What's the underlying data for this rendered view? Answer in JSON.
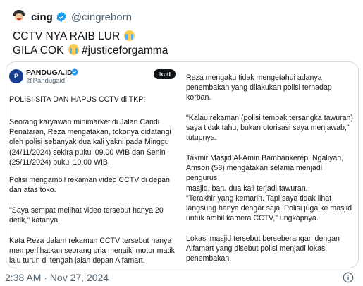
{
  "header": {
    "name": "cing",
    "handle": "@cingreborn"
  },
  "tweet": {
    "line1_text": "CCTV NYA RAIB LUR",
    "line2_text": "GILA COK",
    "hashtag": "#justiceforgamma"
  },
  "media": {
    "account_name": "PANDUGA.ID",
    "account_handle": "@Pandugaid",
    "follow_label": "Ikuti",
    "left_paragraphs": [
      "POLISI SITA DAN HAPUS CCTV di TKP:",
      "Seorang karyawan minimarket di Jalan Candi\nPenataran, Reza mengatakan, tokonya didatangi\noleh polisi sebanyak dua kali yakni pada Minggu\n(24/11/2024) sekira pukul 09.00 WIB dan Senin\n(25/11/2024) pukul 10.00 WIB.",
      "Polisi mengambil rekaman video CCTV di depan\ndan atas toko.",
      " \"Saya sempat melihat video tersebut hanya 20\ndetik,\" katanya.",
      "Kata Reza dalam rekaman CCTV tersebut hanya\nmemperlihatkan seorang pria menaiki motor matik\nlalu turun di tengah jalan depan Alfamart."
    ],
    "right_paragraphs": [
      "Reza mengaku tidak mengetahui adanya\npenembakan yang dilakukan polisi terhadap\nkorban.",
      "\"Kalau rekaman (polisi tembak tersangka tawuran)\nsaya tidak tahu, bukan otorisasi saya menjawab,\"\ntutupnya.",
      "Takmir Masjid Al-Amin Bambankerep, Ngaliyan,\nAmsori (58) mengatakan selama menjadi pengurus\nmasjid, baru dua kali terjadi tawuran.",
      "\"Terakhir yang kemarin. Tapi saya tidak lihat\nlangsung hanya dengar saja. Polisi juga ke masjid\nuntuk ambil kamera CCTV,\" ungkapnya.",
      "Lokasi masjid tersebut berseberangan dengan\nAlfamart yang disebut polisi menjadi lokasi\npenembakan."
    ]
  },
  "footer": {
    "timestamp": "2:38 AM · Nov 27, 2024"
  },
  "colors": {
    "verified": "#1d9bf0",
    "secondary_text": "#536471",
    "border": "#cfd9de"
  }
}
